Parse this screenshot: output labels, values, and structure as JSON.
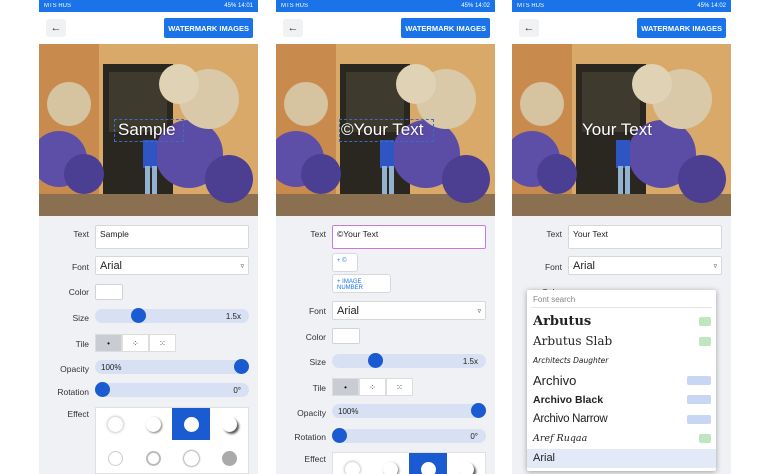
{
  "statusbar": {
    "carrier": "MTS RUS",
    "battery": "45%",
    "times": [
      "14:01",
      "14:02",
      "14:02"
    ]
  },
  "header": {
    "back_icon": "back-arrow-icon",
    "back_glyph": "←",
    "watermark_button": "WATERMARK IMAGES"
  },
  "screens": [
    {
      "watermark_text": "Sample",
      "text_value": "Sample",
      "font": "Arial"
    },
    {
      "watermark_text": "©Your Text",
      "text_value": "©Your Text",
      "font": "Arial",
      "symbol_button": "+ ©",
      "image_number_button": "+ IMAGE NUMBER"
    },
    {
      "watermark_text": "Your Text",
      "text_value": "Your Text",
      "font": "Arial"
    }
  ],
  "labels": {
    "text": "Text",
    "font": "Font",
    "color": "Color",
    "size": "Size",
    "tile": "Tile",
    "opacity": "Opacity",
    "rotation": "Rotation",
    "effect": "Effect"
  },
  "values": {
    "size": "1.5x",
    "size_level": 0.2,
    "opacity": "100%",
    "opacity_level": 1.0,
    "rotation": "0°",
    "rotation_level": 0.0
  },
  "tile_glyphs": [
    "•",
    "⁘",
    "⁙"
  ],
  "font_dropdown": {
    "search_placeholder": "Font search",
    "items": [
      {
        "name": "Arbutus",
        "badge": "green"
      },
      {
        "name": "Arbutus Slab",
        "badge": "green"
      },
      {
        "name": "Architects Daughter",
        "badge": ""
      },
      {
        "name": "Archivo",
        "badge": "blue"
      },
      {
        "name": "Archivo Black",
        "badge": "blue"
      },
      {
        "name": "Archivo Narrow",
        "badge": "blue"
      },
      {
        "name": "Aref Ruqaa",
        "badge": "green"
      },
      {
        "name": "Arial",
        "badge": ""
      }
    ]
  },
  "colors": {
    "accent": "#1a73e8",
    "slider_track": "#d8e1f3",
    "knob": "#1a5bd1",
    "focused_border": "#c77bd9"
  }
}
